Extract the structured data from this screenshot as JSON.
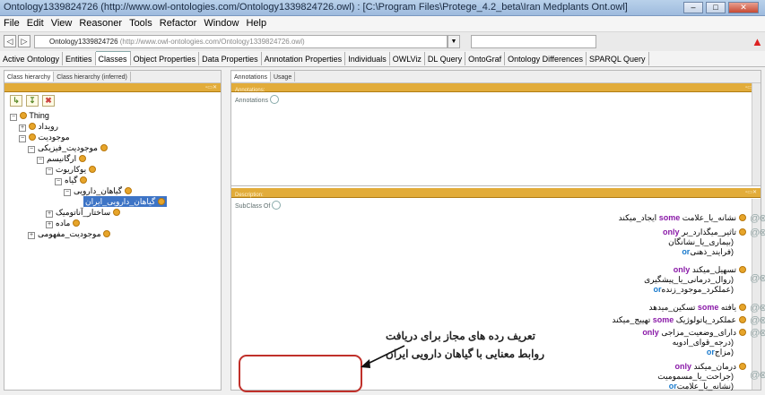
{
  "window": {
    "title": "Ontology1339824726 (http://www.owl-ontologies.com/Ontology1339824726.owl) : [C:\\Program Files\\Protege_4.2_beta\\Iran Medplants Ont.owl]",
    "min_label": "–",
    "max_label": "□",
    "close_label": "✕"
  },
  "menu": [
    "File",
    "Edit",
    "View",
    "Reasoner",
    "Tools",
    "Refactor",
    "Window",
    "Help"
  ],
  "address": {
    "back_label": "◁",
    "forward_label": "▷",
    "ontology_name": "Ontology1339824726",
    "ontology_uri": "(http://www.owl-ontologies.com/Ontology1339824726.owl)",
    "dropdown_label": "▼"
  },
  "tabs": [
    {
      "label": "Active Ontology",
      "active": false
    },
    {
      "label": "Entities",
      "active": false
    },
    {
      "label": "Classes",
      "active": true
    },
    {
      "label": "Object Properties",
      "active": false
    },
    {
      "label": "Data Properties",
      "active": false
    },
    {
      "label": "Annotation Properties",
      "active": false
    },
    {
      "label": "Individuals",
      "active": false
    },
    {
      "label": "OWLViz",
      "active": false
    },
    {
      "label": "DL Query",
      "active": false
    },
    {
      "label": "OntoGraf",
      "active": false
    },
    {
      "label": "Ontology Differences",
      "active": false
    },
    {
      "label": "SPARQL Query",
      "active": false
    }
  ],
  "left_panel": {
    "subtabs": [
      "Class hierarchy",
      "Class hierarchy (inferred)"
    ],
    "tool_buttons": [
      "↳",
      "↧",
      "✖"
    ],
    "tree": [
      {
        "label": "Thing",
        "expanded": true,
        "selected": false
      },
      {
        "label": "رویداد",
        "expanded": false,
        "selected": false
      },
      {
        "label": "موجودیت",
        "expanded": true,
        "selected": false
      },
      {
        "label": "موجودیت_فیزیکی",
        "expanded": true,
        "selected": false
      },
      {
        "label": "ارگانیسم",
        "expanded": true,
        "selected": false
      },
      {
        "label": "یوکاریوت",
        "expanded": true,
        "selected": false
      },
      {
        "label": "گیاه",
        "expanded": true,
        "selected": false
      },
      {
        "label": "گیاهان_دارویی",
        "expanded": true,
        "selected": false
      },
      {
        "label": "گیاهان_دارویی_ایران",
        "expanded": false,
        "selected": true
      },
      {
        "label": "ساختار_آناتومیک",
        "expanded": false,
        "selected": false
      },
      {
        "label": "ماده",
        "expanded": false,
        "selected": false
      },
      {
        "label": "موجودیت_مفهومی",
        "expanded": false,
        "selected": false
      }
    ]
  },
  "annotations_panel": {
    "subtabs": [
      "Annotations",
      "Usage"
    ],
    "header": "Annotations:",
    "row_label": "Annotations"
  },
  "description_panel": {
    "header": "Description:",
    "row_label": "SubClass Of",
    "restrictions": [
      {
        "lines": [
          {
            "prop": "نشانه_یا_علامت",
            "kw": "some",
            "filler": "ایجاد_میکند"
          }
        ]
      },
      {
        "lines": [
          {
            "prop": "تاثیر_میگذارد_بر",
            "kw": "only",
            "filler": ""
          },
          {
            "text": "(بیماری_یا_نشانگان"
          },
          {
            "text": "(فرایند_ذهنی",
            "or": "or"
          }
        ]
      },
      {
        "lines": [
          {
            "prop": "تسهیل_میکند",
            "kw": "only",
            "filler": ""
          },
          {
            "text": "(روال_درمانی_یا_پیشگیری"
          },
          {
            "text": "(عملکرد_موجود_زنده",
            "or": "or"
          }
        ]
      },
      {
        "lines": [
          {
            "prop": "یافته",
            "kw": "some",
            "filler": "تسکین_میدهد"
          }
        ]
      },
      {
        "lines": [
          {
            "prop": "عملکرد_پاتولوژیک",
            "kw": "some",
            "filler": "تهییج_میکند"
          }
        ]
      },
      {
        "lines": [
          {
            "prop": "دارای_وضعیت_مزاجی",
            "kw": "only",
            "filler": ""
          },
          {
            "text": "(درجه_قوای_ادویه"
          },
          {
            "text": "(مزاج",
            "or": "or"
          }
        ]
      },
      {
        "lines": [
          {
            "prop": "درمان_میکند",
            "kw": "only",
            "filler": ""
          },
          {
            "text": "(جراحت_یا_مسمومیت"
          },
          {
            "text": "(نشانه_یا_علامت",
            "or": "or"
          }
        ]
      }
    ],
    "row_icons": "@⊗⊙⊙"
  },
  "annotation_note": {
    "line1": "تعریف رده های مجاز برای دریافت",
    "line2": "روابط معنایی با گیاهان دارویی ایران"
  }
}
